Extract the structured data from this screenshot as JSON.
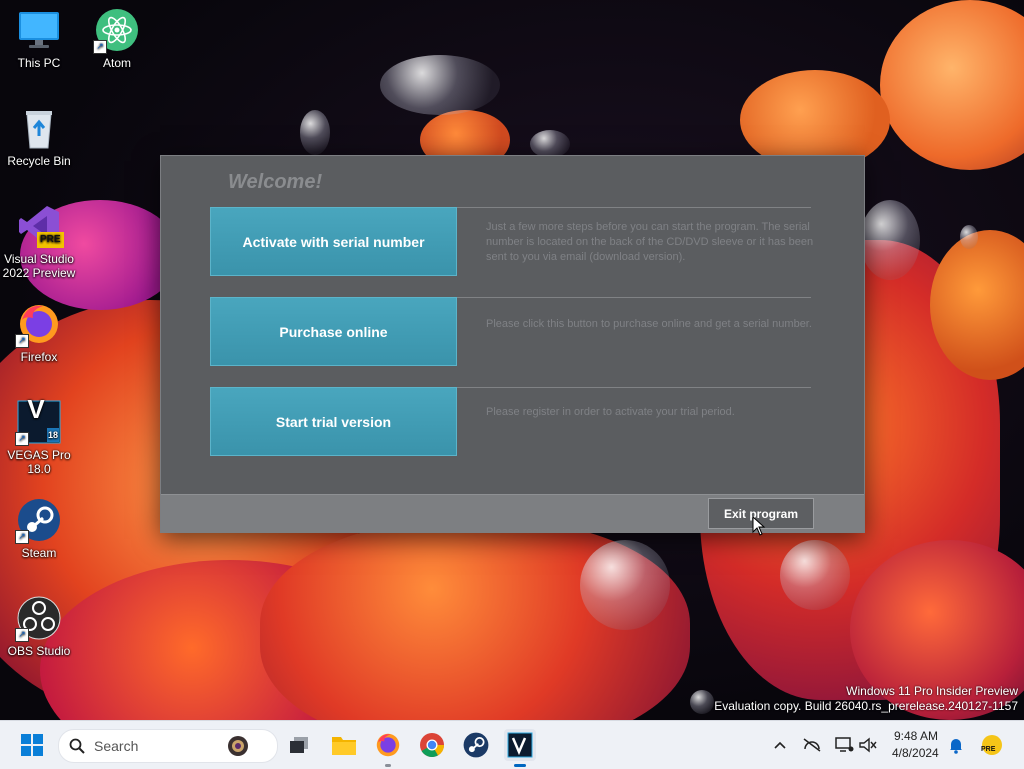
{
  "desktop": {
    "icons": [
      {
        "label": "This PC",
        "icon": "monitor-icon"
      },
      {
        "label": "Atom",
        "icon": "atom-icon"
      },
      {
        "label": "Recycle Bin",
        "icon": "recycle-bin-icon"
      },
      {
        "label": "Visual Studio\n2022 Preview",
        "icon": "visual-studio-icon",
        "badge": "PRE"
      },
      {
        "label": "Firefox",
        "icon": "firefox-icon"
      },
      {
        "label": "VEGAS Pro\n18.0",
        "icon": "vegas-icon",
        "glyph": "V",
        "version": "18"
      },
      {
        "label": "Steam",
        "icon": "steam-icon"
      },
      {
        "label": "OBS Studio",
        "icon": "obs-icon"
      }
    ],
    "watermark": {
      "line1": "Windows 11 Pro Insider Preview",
      "line2": "Evaluation copy. Build 26040.rs_prerelease.240127-1157"
    }
  },
  "dialog": {
    "title": "Welcome!",
    "options": [
      {
        "label": "Activate with serial number",
        "description": "Just a few more steps before you can start the program. The serial number is located on the back of the CD/DVD sleeve or it has been sent to you via email (download version)."
      },
      {
        "label": "Purchase online",
        "description": "Please click this button to purchase online and get a serial number."
      },
      {
        "label": "Start trial version",
        "description": "Please register in order to activate your trial period."
      }
    ],
    "exit_label": "Exit program"
  },
  "taskbar": {
    "search_placeholder": "Search",
    "apps": [
      "start-icon",
      "task-view-icon",
      "file-explorer-icon",
      "firefox-icon",
      "chrome-icon",
      "steam-icon",
      "vegas-icon"
    ],
    "tray": {
      "time": "9:48 AM",
      "date": "4/8/2024",
      "badge": "PRE"
    }
  },
  "colors": {
    "accent": "#3a93ab",
    "dialog_bg": "#5b5d60",
    "taskbar_bg": "#eef1f6"
  }
}
